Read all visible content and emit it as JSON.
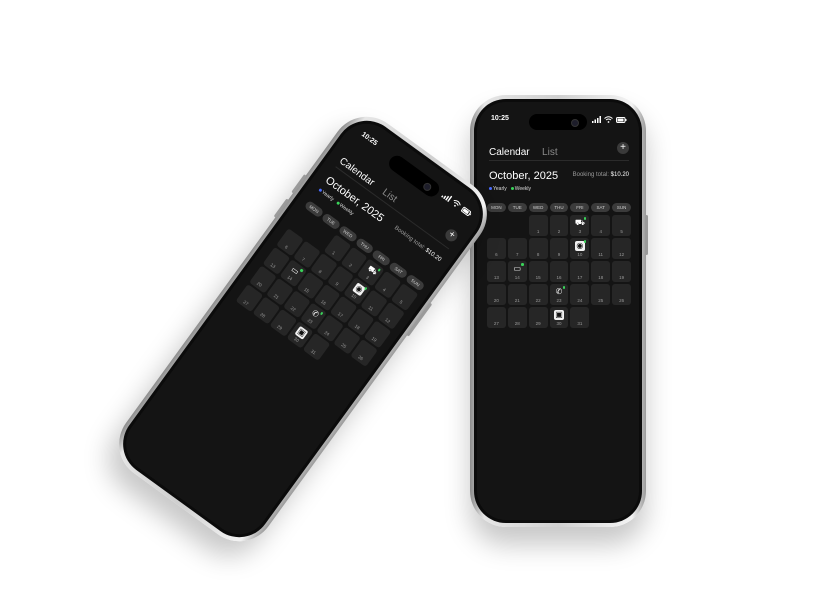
{
  "status": {
    "time": "10:25"
  },
  "header": {
    "tabs": [
      "Calendar",
      "List"
    ],
    "add_label": "+"
  },
  "summary": {
    "month": "October, 2025",
    "booking_label": "Booking total:",
    "booking_value": "$10.20"
  },
  "legend": [
    {
      "label": "Yearly",
      "color": "#4a6cff"
    },
    {
      "label": "Weekly",
      "color": "#3ad45a"
    }
  ],
  "weekdays": [
    "MON",
    "TUE",
    "WED",
    "THU",
    "FRI",
    "SAT",
    "SUN"
  ],
  "days": [
    {
      "d": ""
    },
    {
      "d": ""
    },
    {
      "d": "1"
    },
    {
      "d": "2"
    },
    {
      "d": "3",
      "icon": "car-icon",
      "glyph": "⛟",
      "dot": true
    },
    {
      "d": "4"
    },
    {
      "d": "5"
    },
    {
      "d": "6"
    },
    {
      "d": "7"
    },
    {
      "d": "8"
    },
    {
      "d": "9"
    },
    {
      "d": "10",
      "icon": "ring-icon",
      "glyph": "◉",
      "dot": true,
      "white": true
    },
    {
      "d": "11"
    },
    {
      "d": "12"
    },
    {
      "d": "13"
    },
    {
      "d": "14",
      "icon": "chat-icon",
      "glyph": "▭",
      "dot": true
    },
    {
      "d": "15"
    },
    {
      "d": "16"
    },
    {
      "d": "17"
    },
    {
      "d": "18"
    },
    {
      "d": "19"
    },
    {
      "d": "20"
    },
    {
      "d": "21"
    },
    {
      "d": "22"
    },
    {
      "d": "23",
      "icon": "phone-icon",
      "glyph": "✆",
      "dot": true
    },
    {
      "d": "24"
    },
    {
      "d": "25"
    },
    {
      "d": "26"
    },
    {
      "d": "27"
    },
    {
      "d": "28"
    },
    {
      "d": "29"
    },
    {
      "d": "30",
      "icon": "card-icon",
      "glyph": "▣",
      "dot": false,
      "white": true
    },
    {
      "d": "31"
    }
  ]
}
